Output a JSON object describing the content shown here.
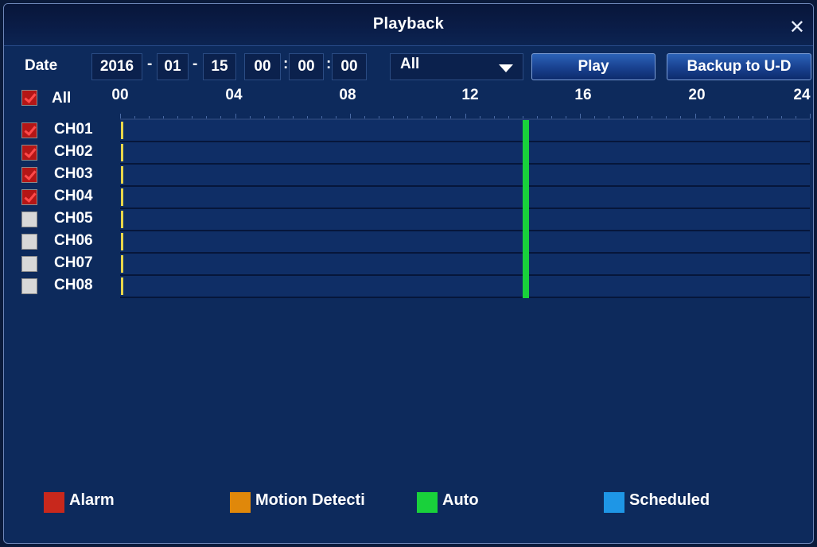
{
  "window": {
    "title": "Playback",
    "close_icon": "close-icon"
  },
  "date_label": "Date",
  "date": {
    "year": "2016",
    "month": "01",
    "day": "15",
    "sep": "-"
  },
  "time": {
    "hh": "00",
    "mm": "00",
    "ss": "00",
    "sep": ":"
  },
  "type_select": {
    "value": "All",
    "icon": "chevron-down-icon"
  },
  "buttons": {
    "play": "Play",
    "backup": "Backup to U-D"
  },
  "all_checkbox": {
    "label": "All",
    "checked": true
  },
  "time_axis": [
    "00",
    "04",
    "08",
    "12",
    "16",
    "20",
    "24"
  ],
  "channels": [
    {
      "name": "CH01",
      "checked": true
    },
    {
      "name": "CH02",
      "checked": true
    },
    {
      "name": "CH03",
      "checked": true
    },
    {
      "name": "CH04",
      "checked": true
    },
    {
      "name": "CH05",
      "checked": false
    },
    {
      "name": "CH06",
      "checked": false
    },
    {
      "name": "CH07",
      "checked": false
    },
    {
      "name": "CH08",
      "checked": false
    }
  ],
  "recording_hour": 14,
  "legend": [
    {
      "label": "Alarm",
      "color": "#c8281c"
    },
    {
      "label": "Motion Detecti",
      "color": "#e0880a"
    },
    {
      "label": "Auto",
      "color": "#19d13b"
    },
    {
      "label": "Scheduled",
      "color": "#1e96e6"
    }
  ],
  "colors": {
    "background": "#0d2a5c",
    "record_marker": "#e8d64a",
    "record_auto": "#19d13b"
  }
}
